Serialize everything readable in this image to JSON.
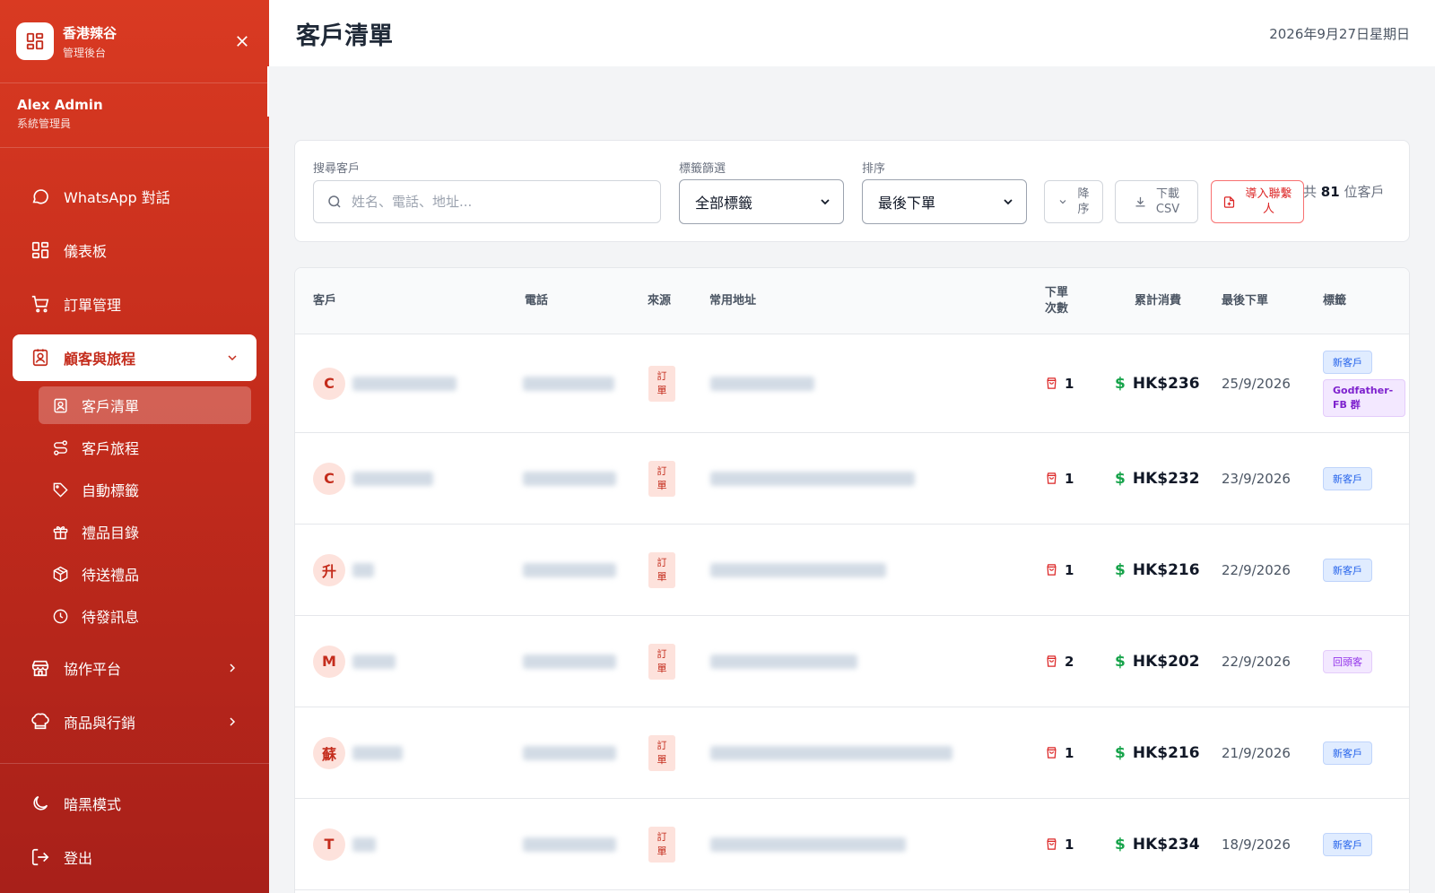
{
  "brand": {
    "name": "香港辣谷",
    "subtitle": "管理後台"
  },
  "user": {
    "name": "Alex Admin",
    "role": "系統管理員"
  },
  "nav": {
    "whatsapp": "WhatsApp 對話",
    "dashboard": "儀表板",
    "orders": "訂單管理",
    "customers_journey": "顧客與旅程",
    "collab": "協作平台",
    "products": "商品與行銷"
  },
  "subnav": {
    "customer_list": "客戶清單",
    "customer_journey": "客戶旅程",
    "auto_tags": "自動標籤",
    "gift_catalog": "禮品目錄",
    "pending_gifts": "待送禮品",
    "pending_messages": "待發訊息"
  },
  "bottom": {
    "dark_mode": "暗黑模式",
    "logout": "登出"
  },
  "header": {
    "title": "客戶清單",
    "date": "2026年9月27日星期日"
  },
  "filters": {
    "search_label": "搜尋客戶",
    "search_placeholder": "姓名、電話、地址...",
    "tag_label": "標籤篩選",
    "tag_value": "全部標籤",
    "sort_label": "排序",
    "sort_value": "最後下單",
    "desc_line1": "降",
    "desc_line2": "序",
    "csv_line1": "下載",
    "csv_line2": "CSV",
    "import_line1": "導入聯繫",
    "import_line2": "人",
    "count_prefix": "共",
    "count_value": "81",
    "count_suffix": "位客戶"
  },
  "table": {
    "headers": {
      "customer": "客戶",
      "phone": "電話",
      "source": "來源",
      "address": "常用地址",
      "orders_line1": "下單",
      "orders_line2": "次數",
      "spent": "累計消費",
      "last_order": "最後下單",
      "tags": "標籤"
    },
    "source_label_1": "訂",
    "source_label_2": "單",
    "rows": [
      {
        "initial": "C",
        "orders": "1",
        "spent": "HK$236",
        "last": "25/9/2026",
        "tag1": "新客戶",
        "tag2": "Godfather-FB 群"
      },
      {
        "initial": "C",
        "orders": "1",
        "spent": "HK$232",
        "last": "23/9/2026",
        "tag1": "新客戶"
      },
      {
        "initial": "升",
        "orders": "1",
        "spent": "HK$216",
        "last": "22/9/2026",
        "tag1": "新客戶"
      },
      {
        "initial": "M",
        "orders": "2",
        "spent": "HK$202",
        "last": "22/9/2026",
        "tag1": "回頭客"
      },
      {
        "initial": "蘇",
        "orders": "1",
        "spent": "HK$216",
        "last": "21/9/2026",
        "tag1": "新客戶"
      },
      {
        "initial": "T",
        "orders": "1",
        "spent": "HK$234",
        "last": "18/9/2026",
        "tag1": "新客戶"
      }
    ]
  },
  "colors": {
    "brand_red": "#c42c1c",
    "money_green": "#16a34a",
    "tag_blue": "#2563eb",
    "tag_purple": "#9333ea"
  }
}
